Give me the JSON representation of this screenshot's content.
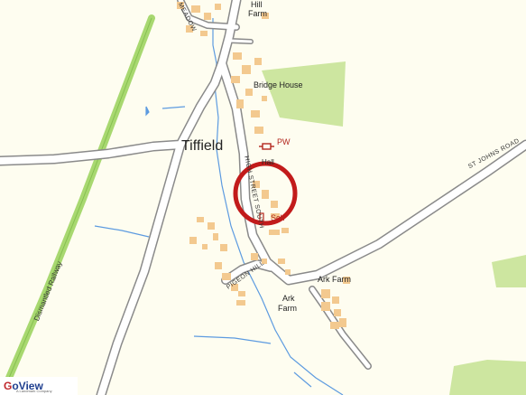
{
  "colors": {
    "background": "#fefdf0",
    "road_fill": "#ffffff",
    "road_casing": "#8a8a8a",
    "building": "#f3c98f",
    "water": "#5d9be0",
    "green": "#cde6a0",
    "railway": "#a8d870",
    "marker": "#c21b1b",
    "school": "#b3261e"
  },
  "labels": {
    "hill_farm_1": "Hill",
    "hill_farm_2": "Farm",
    "bridge_house": "Bridge House",
    "tiffield": "Tiffield",
    "pw": "PW",
    "hall": "Hall",
    "school": "Sch",
    "ark_farm_east": "Ark Farm",
    "ark_farm_south_1": "Ark",
    "ark_farm_south_2": "Farm"
  },
  "roads": {
    "st_johns_road": "ST JOHNS ROAD",
    "high_street_south": "HIGH STREET SOUTH",
    "pigeon_hill": "PIGEON HILL",
    "meadow": "MEADOW",
    "dismantled_railway": "Dismantled Railway"
  },
  "icons": {
    "place_of_worship": "place-of-worship-icon",
    "location_marker": "location-circle-icon"
  },
  "logo": {
    "mark": "G",
    "name": "oView",
    "tagline": "A Landmark Company"
  }
}
